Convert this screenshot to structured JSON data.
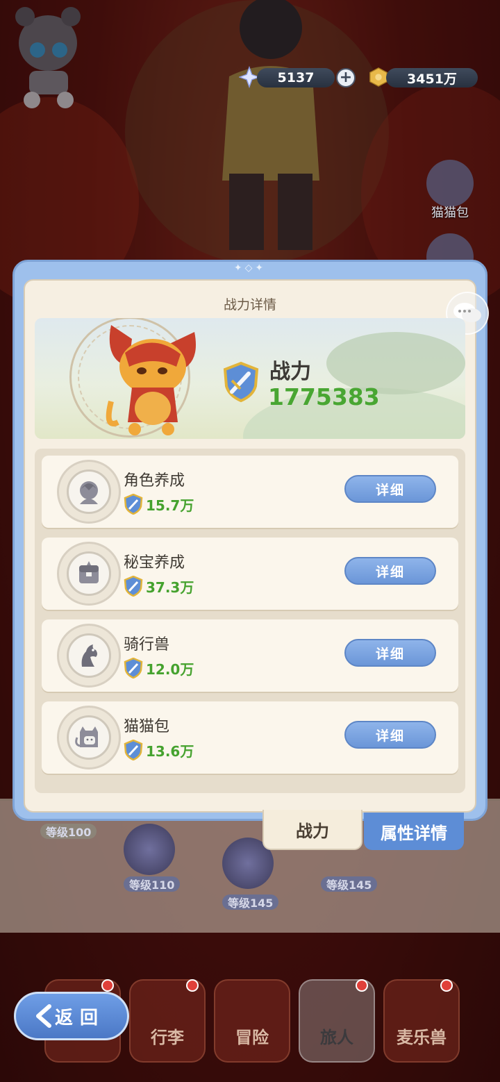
{
  "currency": {
    "gems": "5137",
    "coins": "3451万"
  },
  "side": {
    "cat_bag": "猫猫包"
  },
  "dialog": {
    "title": "战力详情",
    "power_label": "战力",
    "power_value": "1775383",
    "rows": [
      {
        "title": "角色养成",
        "value": "15.7万",
        "button": "详细",
        "icon": "character-icon"
      },
      {
        "title": "秘宝养成",
        "value": "37.3万",
        "button": "详细",
        "icon": "treasure-icon"
      },
      {
        "title": "骑行兽",
        "value": "12.0万",
        "button": "详细",
        "icon": "horse-icon"
      },
      {
        "title": "猫猫包",
        "value": "13.6万",
        "button": "详细",
        "icon": "cat-bag-icon"
      }
    ],
    "tabs": {
      "power": "战力",
      "attributes": "属性详情"
    }
  },
  "background_board": {
    "levels": [
      "等级100",
      "等级110",
      "等级145",
      "等级145"
    ]
  },
  "bottom_nav": {
    "back": "返回",
    "items": [
      "行李",
      "冒险",
      "旅人",
      "麦乐兽"
    ],
    "active": "旅人"
  },
  "colors": {
    "accent_blue": "#6b96d8",
    "power_green": "#48a632",
    "panel_cream": "#f6efe2"
  }
}
